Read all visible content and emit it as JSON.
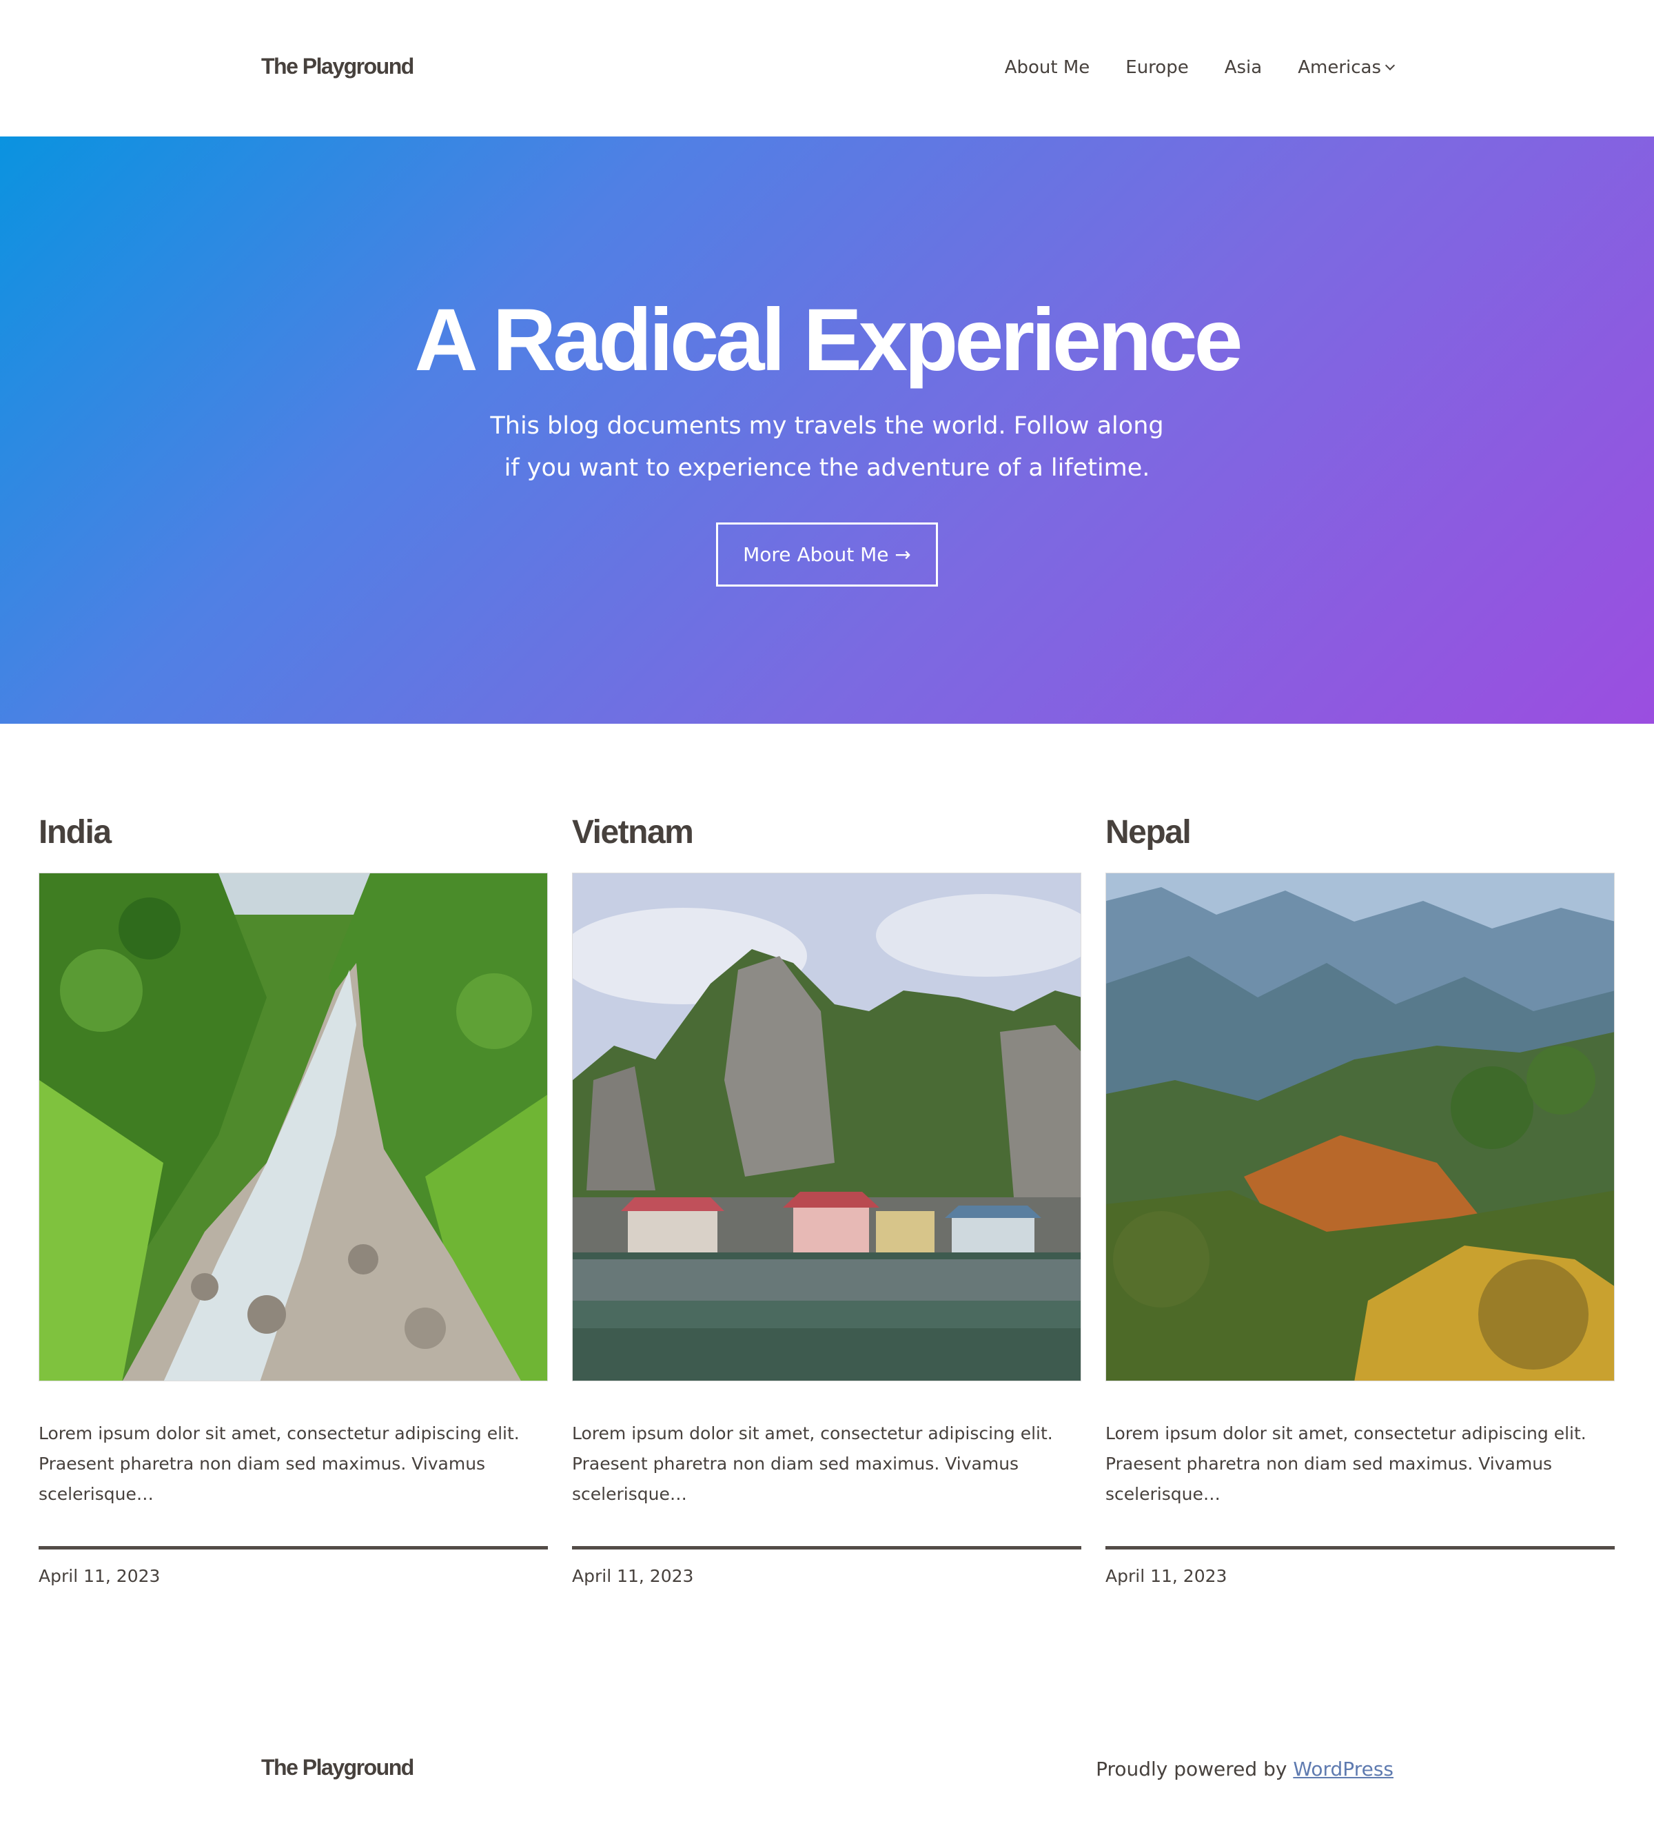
{
  "header": {
    "site_title": "The Playground",
    "nav": [
      {
        "label": "About Me"
      },
      {
        "label": "Europe"
      },
      {
        "label": "Asia"
      },
      {
        "label": "Americas"
      }
    ]
  },
  "hero": {
    "title": "A Radical Experience",
    "subtitle": "This blog documents my travels the world. Follow along if you want to experience the adventure of a lifetime.",
    "button_label": "More About Me →",
    "gradient_colors": [
      "#0a93e0",
      "#9b4ee0"
    ]
  },
  "posts": [
    {
      "title": "India",
      "image_icon": "river-landscape-photo",
      "excerpt": "Lorem ipsum dolor sit amet, consectetur adipiscing elit. Praesent pharetra non diam sed maximus. Vivamus scelerisque…",
      "date": "April 11, 2023"
    },
    {
      "title": "Vietnam",
      "image_icon": "karst-floating-village-photo",
      "excerpt": "Lorem ipsum dolor sit amet, consectetur adipiscing elit. Praesent pharetra non diam sed maximus. Vivamus scelerisque…",
      "date": "April 11, 2023"
    },
    {
      "title": "Nepal",
      "image_icon": "mountain-valley-photo",
      "excerpt": "Lorem ipsum dolor sit amet, consectetur adipiscing elit. Praesent pharetra non diam sed maximus. Vivamus scelerisque…",
      "date": "April 11, 2023"
    }
  ],
  "footer": {
    "site_title": "The Playground",
    "credit_prefix": "Proudly powered by ",
    "credit_link": "WordPress"
  }
}
